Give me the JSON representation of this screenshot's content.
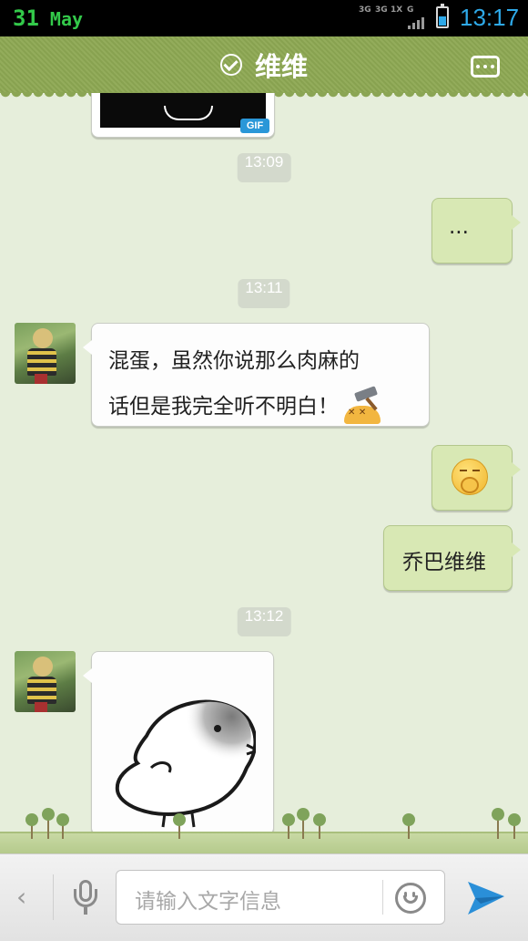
{
  "status_bar": {
    "day": "31",
    "month": "May",
    "network_labels": [
      "3G",
      "3G",
      "1X",
      "G"
    ],
    "time": "13:17",
    "icons": [
      "signal-icon",
      "battery-icon"
    ],
    "accent_colors": {
      "date": "#33c94a",
      "time": "#2ea9e9"
    }
  },
  "header": {
    "title": "维维",
    "status_icon": "verified-check-icon",
    "menu_icon": "more-icon",
    "color": "#8ba554"
  },
  "messages": [
    {
      "type": "image",
      "direction": "in",
      "badge": "GIF"
    },
    {
      "type": "timestamp",
      "text": "13:09"
    },
    {
      "type": "text",
      "direction": "out",
      "text": "..."
    },
    {
      "type": "timestamp",
      "text": "13:11"
    },
    {
      "type": "text",
      "direction": "in",
      "lines": [
        "混蛋，虽然你说那么肉麻的",
        "话但是我完全听不明白！"
      ],
      "emoji": "hammer-emoji"
    },
    {
      "type": "emoji",
      "direction": "out",
      "emoji": "yawn-emoji"
    },
    {
      "type": "text",
      "direction": "out",
      "text": "乔巴维维"
    },
    {
      "type": "timestamp",
      "text": "13:12"
    },
    {
      "type": "sticker",
      "direction": "in",
      "sticker": "bird-sticker"
    }
  ],
  "input_bar": {
    "placeholder": "请输入文字信息",
    "icons": [
      "back-icon",
      "mic-icon",
      "smiley-icon",
      "send-icon"
    ],
    "send_color": "#2a8fd8"
  }
}
